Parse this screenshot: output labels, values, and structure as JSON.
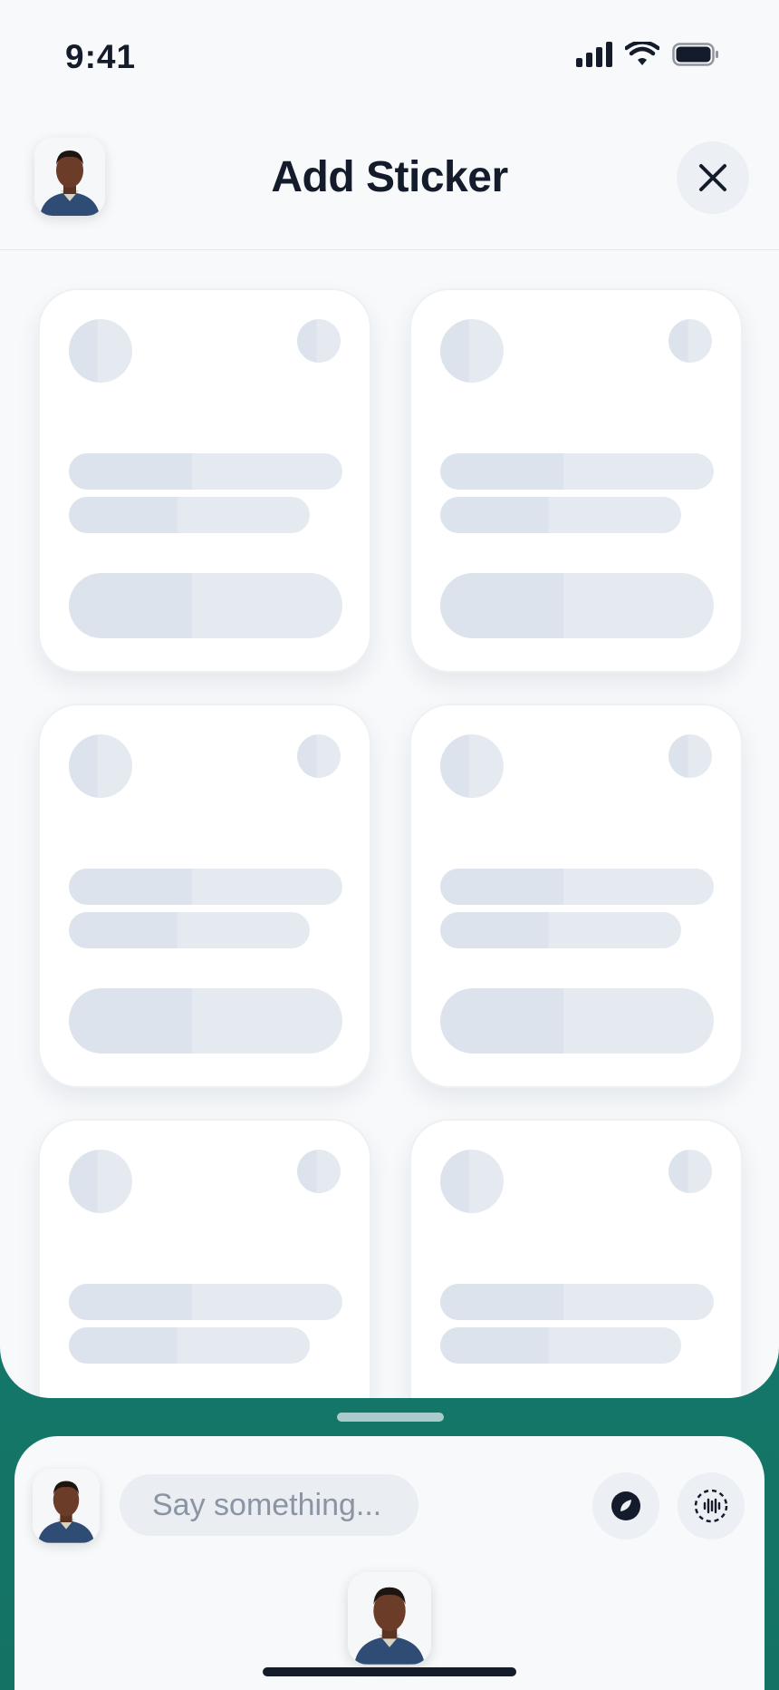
{
  "status_bar": {
    "time": "9:41",
    "icons": [
      "signal-icon",
      "wifi-icon",
      "battery-icon"
    ]
  },
  "header": {
    "title": "Add Sticker",
    "avatar_icon": "user-avatar",
    "close_icon": "close-icon"
  },
  "sticker_grid": {
    "state": "loading",
    "cards": [
      {
        "id": "card-1"
      },
      {
        "id": "card-2"
      },
      {
        "id": "card-3"
      },
      {
        "id": "card-4"
      },
      {
        "id": "card-5"
      },
      {
        "id": "card-6"
      }
    ]
  },
  "composer": {
    "placeholder": "Say something...",
    "avatar_icon": "user-avatar",
    "sticker_icon": "sticker-icon",
    "voice_icon": "voice-icon"
  },
  "colors": {
    "background_teal": "#1b8a79",
    "sheet": "#f7f9fb",
    "text_dark": "#141b2b",
    "skeleton": "#dce3ec"
  }
}
